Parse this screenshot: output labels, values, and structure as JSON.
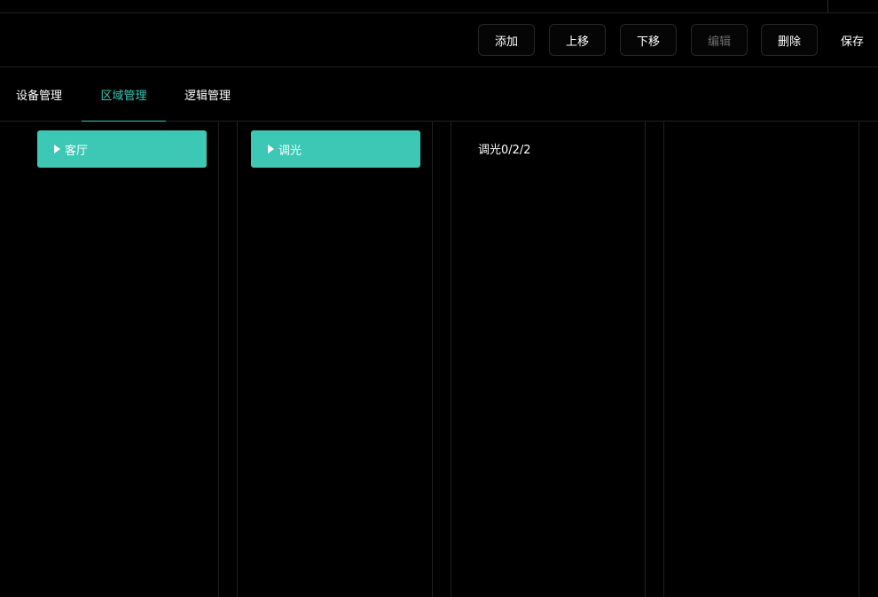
{
  "toolbar": {
    "add_label": "添加",
    "move_up_label": "上移",
    "move_down_label": "下移",
    "edit_label": "编辑",
    "delete_label": "删除",
    "save_label": "保存"
  },
  "tabs": [
    {
      "label": "设备管理",
      "active": false
    },
    {
      "label": "区域管理",
      "active": true
    },
    {
      "label": "逻辑管理",
      "active": false
    }
  ],
  "columns": {
    "area": {
      "label": "客厅"
    },
    "group": {
      "label": "调光"
    },
    "item": {
      "label": "调光0/2/2"
    }
  },
  "colors": {
    "accent": "#3cc8b4",
    "background": "#000000",
    "border": "#202020",
    "disabled_text": "#6d6d6d"
  }
}
